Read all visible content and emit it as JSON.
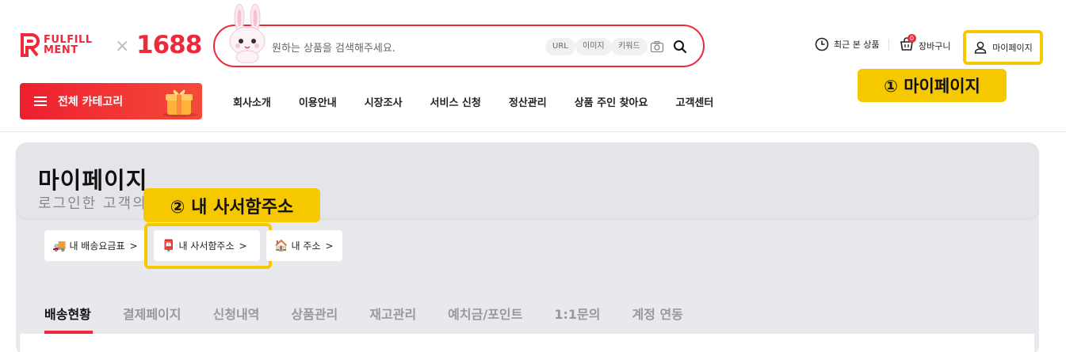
{
  "brand": {
    "logo_line1": "FULFILL",
    "logo_line2": "MENT",
    "separator": "×",
    "partner": "1688",
    "accent_color": "#ee2a3a"
  },
  "search": {
    "placeholder": "원하는 상품을 검색해주세요.",
    "chips": [
      "URL",
      "이미지",
      "키워드"
    ],
    "camera_icon": "camera-icon",
    "search_icon": "search-icon"
  },
  "util": {
    "recent_label": "최근 본 상품",
    "cart_label": "장바구니",
    "cart_count": "0",
    "mypage_label": "마이페이지"
  },
  "callouts": {
    "one": "① 마이페이지",
    "two": "② 내 사서함주소",
    "color": "#f6c800"
  },
  "category_button": {
    "label": "전체 카테고리"
  },
  "nav": [
    "회사소개",
    "이용안내",
    "시장조사",
    "서비스 신청",
    "정산관리",
    "상품 주인 찾아요",
    "고객센터"
  ],
  "page": {
    "title": "마이페이지",
    "subtitle": "로그인한 고객의"
  },
  "quick_links": [
    {
      "emoji": "🚚",
      "label": "내 배송요금표",
      "chevron": ">"
    },
    {
      "emoji": "📮",
      "label": "내 사서함주소",
      "chevron": ">"
    },
    {
      "emoji": "🏠",
      "label": "내 주소",
      "chevron": ">"
    }
  ],
  "tabs": [
    "배송현황",
    "결제페이지",
    "신청내역",
    "상품관리",
    "재고관리",
    "예치금/포인트",
    "1:1문의",
    "계정 연동"
  ],
  "active_tab": "배송현황"
}
